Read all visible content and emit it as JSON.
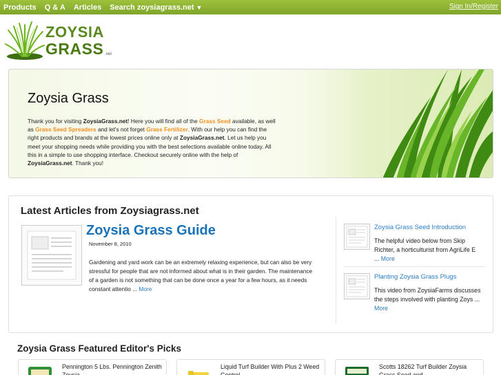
{
  "nav": {
    "items": [
      "Products",
      "Q & A",
      "Articles",
      "Search zoysiagrass.net"
    ],
    "signin": "Sign In/Register"
  },
  "logo": {
    "line1": "ZOYSIA",
    "line2": "GRASS",
    "suffix": ".net"
  },
  "hero": {
    "title": "Zoysia Grass",
    "p1": "Thank you for visiting ",
    "site1": "ZoysiaGrass.net",
    "p2": "! Here you will find all of the ",
    "link1": "Grass Seed",
    "p3": " available, as well as ",
    "link2": "Grass Seed Spreaders",
    "p4": " and let's not forget ",
    "link3": "Grass Fertilizer",
    "p5": ". With our help you can find the right products and brands at the lowest prices online only at ",
    "site2": "ZoysiaGrass.net",
    "p6": ". Let us help you meet your shopping needs while providing you with the best selections available online today. All this in a simple to use shopping interface. Checkout securely online with the help of ",
    "site3": "ZoysiaGrass.net",
    "p7": ". Thank you!"
  },
  "articles": {
    "heading": "Latest Articles from Zoysiagrass.net",
    "main": {
      "title": "Zoysia Grass Guide",
      "date": "November 8, 2010",
      "body": "Gardening and yard work can be an extremely relaxing experience, but can also be very stressful for people that are not informed about what is in their garden. The maintenance of a garden is not something that can be done once a year for a few hours, as it needs constant attentio ...",
      "more": "More"
    },
    "side": [
      {
        "title": "Zoysia Grass Seed Introduction",
        "body": "The helpful video below from Skip Richter, a horticulturist from AgriLife E ...",
        "more": "More"
      },
      {
        "title": "Planting Zoysia Grass Plugs",
        "body": "This video from ZoysiaFarms discusses the steps involved with planting Zoys ...",
        "more": "More"
      }
    ]
  },
  "picks": {
    "heading": "Zoysia Grass Featured Editor's Picks",
    "items": [
      {
        "title": "Pennington 5 Lbs. Pennington Zenith Zoysia"
      },
      {
        "title": "Liquid Turf Builder With Plus 2 Weed Control"
      },
      {
        "title": "Scotts 18262 Turf Builder Zoysia Grass Seed and"
      }
    ]
  },
  "colors": {
    "nav_green": "#8fb532",
    "link_blue": "#1a73b8",
    "accent_orange": "#f28c1e"
  }
}
